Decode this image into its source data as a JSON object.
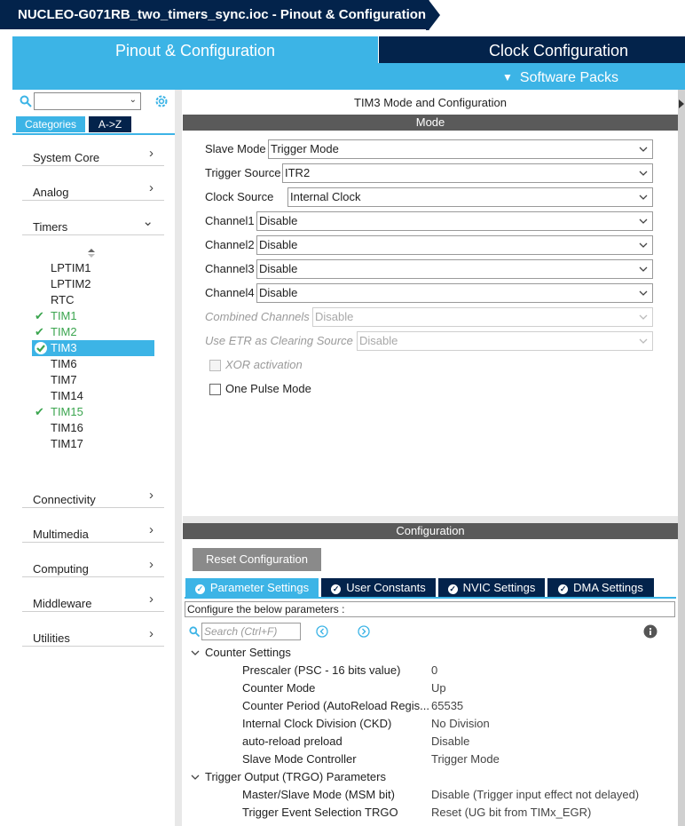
{
  "title_bar": {
    "project_title": "NUCLEO-G071RB_two_timers_sync.ioc - Pinout & Configuration"
  },
  "top_tabs": {
    "pinout": "Pinout & Configuration",
    "clock": "Clock Configuration",
    "software_packs": "Software Packs"
  },
  "colors": {
    "accent": "#3cb4e6",
    "navy": "#03234b",
    "ok_green": "#3ba54f",
    "bar_gray": "#5a5a5a"
  },
  "left": {
    "search_value": "",
    "tabs": {
      "categories": "Categories",
      "az": "A->Z"
    },
    "categories": [
      {
        "label": "System Core",
        "state": "collapsed"
      },
      {
        "label": "Analog",
        "state": "collapsed"
      },
      {
        "label": "Timers",
        "state": "expanded"
      },
      {
        "label": "Connectivity",
        "state": "collapsed"
      },
      {
        "label": "Multimedia",
        "state": "collapsed"
      },
      {
        "label": "Computing",
        "state": "collapsed"
      },
      {
        "label": "Middleware",
        "state": "collapsed"
      },
      {
        "label": "Utilities",
        "state": "collapsed"
      }
    ],
    "timers": [
      {
        "label": "LPTIM1",
        "status": "none"
      },
      {
        "label": "LPTIM2",
        "status": "none"
      },
      {
        "label": "RTC",
        "status": "none"
      },
      {
        "label": "TIM1",
        "status": "ok"
      },
      {
        "label": "TIM2",
        "status": "ok"
      },
      {
        "label": "TIM3",
        "status": "selected"
      },
      {
        "label": "TIM6",
        "status": "none"
      },
      {
        "label": "TIM7",
        "status": "none"
      },
      {
        "label": "TIM14",
        "status": "none"
      },
      {
        "label": "TIM15",
        "status": "ok"
      },
      {
        "label": "TIM16",
        "status": "none"
      },
      {
        "label": "TIM17",
        "status": "none"
      }
    ]
  },
  "mode": {
    "header": "TIM3 Mode and Configuration",
    "bar": "Mode",
    "fields": [
      {
        "label": "Slave Mode",
        "value": "Trigger Mode",
        "enabled": true
      },
      {
        "label": "Trigger Source",
        "value": "ITR2",
        "enabled": true
      },
      {
        "label": "Clock Source",
        "value": "Internal Clock",
        "enabled": true
      },
      {
        "label": "Channel1",
        "value": "Disable",
        "enabled": true
      },
      {
        "label": "Channel2",
        "value": "Disable",
        "enabled": true
      },
      {
        "label": "Channel3",
        "value": "Disable",
        "enabled": true
      },
      {
        "label": "Channel4",
        "value": "Disable",
        "enabled": true
      },
      {
        "label": "Combined Channels",
        "value": "Disable",
        "enabled": false
      },
      {
        "label": "Use ETR as Clearing Source",
        "value": "Disable",
        "enabled": false
      }
    ],
    "checkboxes": [
      {
        "label": "XOR activation",
        "checked": false,
        "enabled": false
      },
      {
        "label": "One Pulse Mode",
        "checked": false,
        "enabled": true
      }
    ]
  },
  "config": {
    "bar": "Configuration",
    "reset_label": "Reset Configuration",
    "tabs": [
      {
        "label": "Parameter Settings",
        "active": true
      },
      {
        "label": "User Constants",
        "active": false
      },
      {
        "label": "NVIC Settings",
        "active": false
      },
      {
        "label": "DMA Settings",
        "active": false
      }
    ],
    "description": "Configure the below parameters :",
    "search_placeholder": "Search (Ctrl+F)",
    "groups": [
      {
        "title": "Counter Settings",
        "params": [
          {
            "name": "Prescaler (PSC - 16 bits value)",
            "value": "0"
          },
          {
            "name": "Counter Mode",
            "value": "Up"
          },
          {
            "name": "Counter Period (AutoReload Regis...",
            "value": "65535"
          },
          {
            "name": "Internal Clock Division (CKD)",
            "value": "No Division"
          },
          {
            "name": "auto-reload preload",
            "value": "Disable"
          },
          {
            "name": "Slave Mode Controller",
            "value": "Trigger Mode"
          }
        ]
      },
      {
        "title": "Trigger Output (TRGO) Parameters",
        "params": [
          {
            "name": "Master/Slave Mode (MSM bit)",
            "value": "Disable (Trigger input effect not delayed)"
          },
          {
            "name": "Trigger Event Selection TRGO",
            "value": "Reset (UG bit from TIMx_EGR)"
          }
        ]
      }
    ]
  }
}
